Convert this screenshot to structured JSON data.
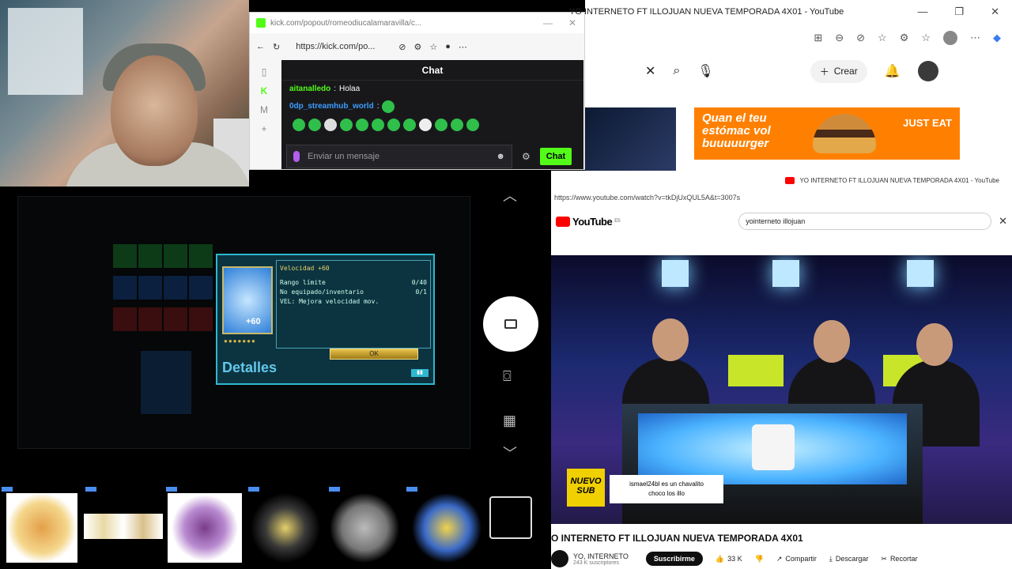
{
  "kick_popup": {
    "url": "kick.com/popout/romeodiucalamaravilla/c...",
    "address_url": "https://kick.com/po...",
    "chat_title": "Chat",
    "messages": [
      {
        "user": "aitanalledo",
        "text": "Holaa"
      },
      {
        "user": "0dp_streamhub_world",
        "text": ""
      }
    ],
    "input_placeholder": "Enviar un mensaje",
    "send_label": "Chat"
  },
  "yt_window": {
    "title": "YO INTERNETO FT ILLOJUAN NUEVA TEMPORADA 4X01 - YouTube",
    "create_label": "Crear",
    "ad": {
      "line1": "Quan el teu",
      "line2": "estómac vol",
      "line3": "buuuuurger",
      "brand": "JUST EAT"
    }
  },
  "game": {
    "item_title": "Velocidad +60",
    "badge": "+60",
    "rows": [
      {
        "label": "Rango límite",
        "value": "0/40"
      },
      {
        "label": "No equipado/inventario",
        "value": "0/1"
      }
    ],
    "effect": "VEL: Mejora velocidad mov.",
    "ok_label": "OK",
    "heading": "Detalles"
  },
  "yt_popup": {
    "tab_title": "YO INTERNETO FT ILLOJUAN NUEVA TEMPORADA 4X01 - YouTube",
    "url": "https://www.youtube.com/watch?v=tkDjUxQUL5A&t=3007s",
    "logo_text": "YouTube",
    "logo_sup": "ES",
    "search_value": "yointerneto illojuan",
    "video_title": "O INTERNETO FT ILLOJUAN NUEVA TEMPORADA 4X01",
    "channel": "YO, INTERNETO",
    "subs": "243 K suscriptores",
    "subscribe_label": "Suscribirme",
    "likes": "33 K",
    "share_label": "Compartir",
    "download_label": "Descargar",
    "clip_label": "Recortar",
    "overlay": {
      "badge_line1": "NUEVO",
      "badge_line2": "SUB",
      "msg_line1": "ismael24bl es un chavalito",
      "msg_line2": "choco los illo"
    }
  },
  "icons": {
    "camera_record": "video-camera-icon",
    "snapshot": "camera-icon",
    "qr": "qr-icon",
    "up": "chevron-up-icon",
    "down": "chevron-down-icon"
  }
}
